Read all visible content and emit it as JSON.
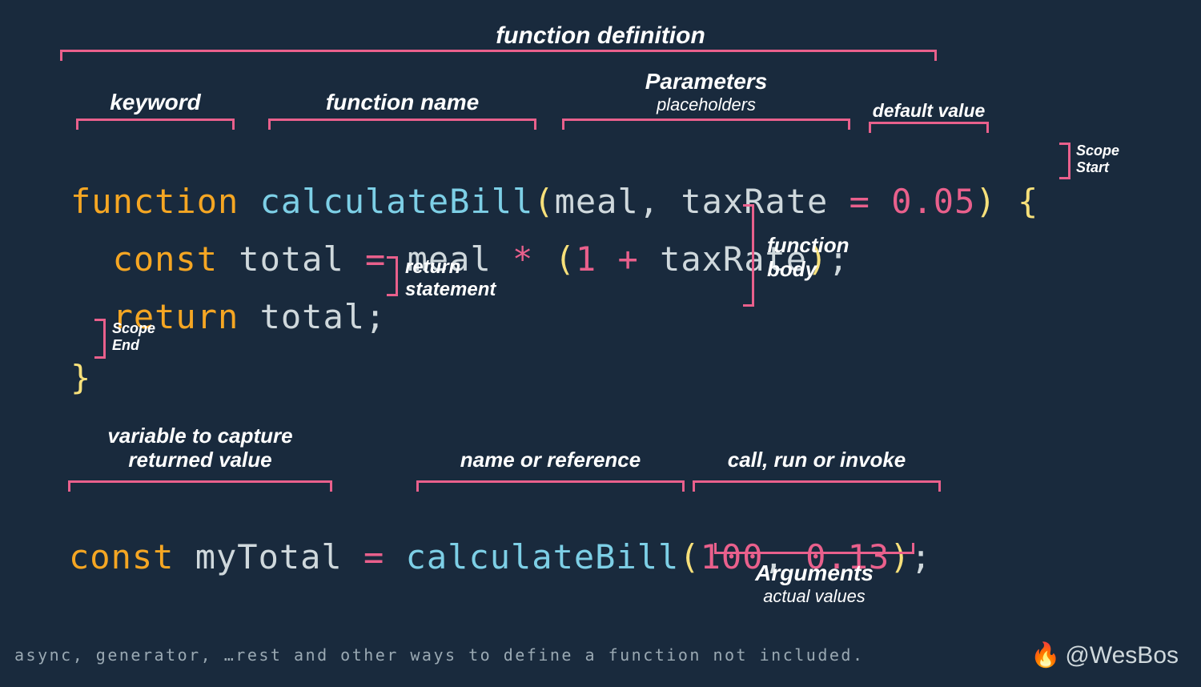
{
  "title_top": "function definition",
  "labels": {
    "keyword": "keyword",
    "function_name": "function name",
    "parameters": "Parameters",
    "parameters_sub": "placeholders",
    "default_value": "default value",
    "scope_start_l1": "Scope",
    "scope_start_l2": "Start",
    "function_body_l1": "function",
    "function_body_l2": "body",
    "return_stmt_l1": "return",
    "return_stmt_l2": "statement",
    "scope_end_l1": "Scope",
    "scope_end_l2": "End",
    "var_capture_l1": "variable to capture",
    "var_capture_l2": "returned value",
    "name_ref": "name or reference",
    "call_invoke": "call, run or invoke",
    "arguments": "Arguments",
    "arguments_sub": "actual values"
  },
  "code": {
    "line1": {
      "kw": "function ",
      "fn": "calculateBill",
      "lparen": "(",
      "p1": "meal",
      "comma": ", ",
      "p2": "taxRate ",
      "eq": "= ",
      "num": "0.05",
      "rparen": ")",
      "sp": " ",
      "lbrace": "{"
    },
    "line2": {
      "indent": "  ",
      "kw": "const ",
      "id": "total ",
      "eq": "= ",
      "id2": "meal ",
      "op": "* ",
      "lp": "(",
      "one": "1 ",
      "plus": "+ ",
      "id3": "taxRate",
      "rp": ")",
      "semi": ";"
    },
    "line3": {
      "indent": "  ",
      "kw": "return ",
      "id": "total",
      "semi": ";"
    },
    "line4": {
      "rbrace": "}"
    },
    "line5": {
      "kw": "const ",
      "id": "myTotal ",
      "eq": "= ",
      "fn": "calculateBill",
      "lp": "(",
      "a1": "100",
      "comma": ", ",
      "a2": "0.13",
      "rp": ")",
      "semi": ";"
    }
  },
  "footer": "async, generator, …rest and other ways to define a function not included.",
  "handle": "@WesBos",
  "fire": "🔥"
}
